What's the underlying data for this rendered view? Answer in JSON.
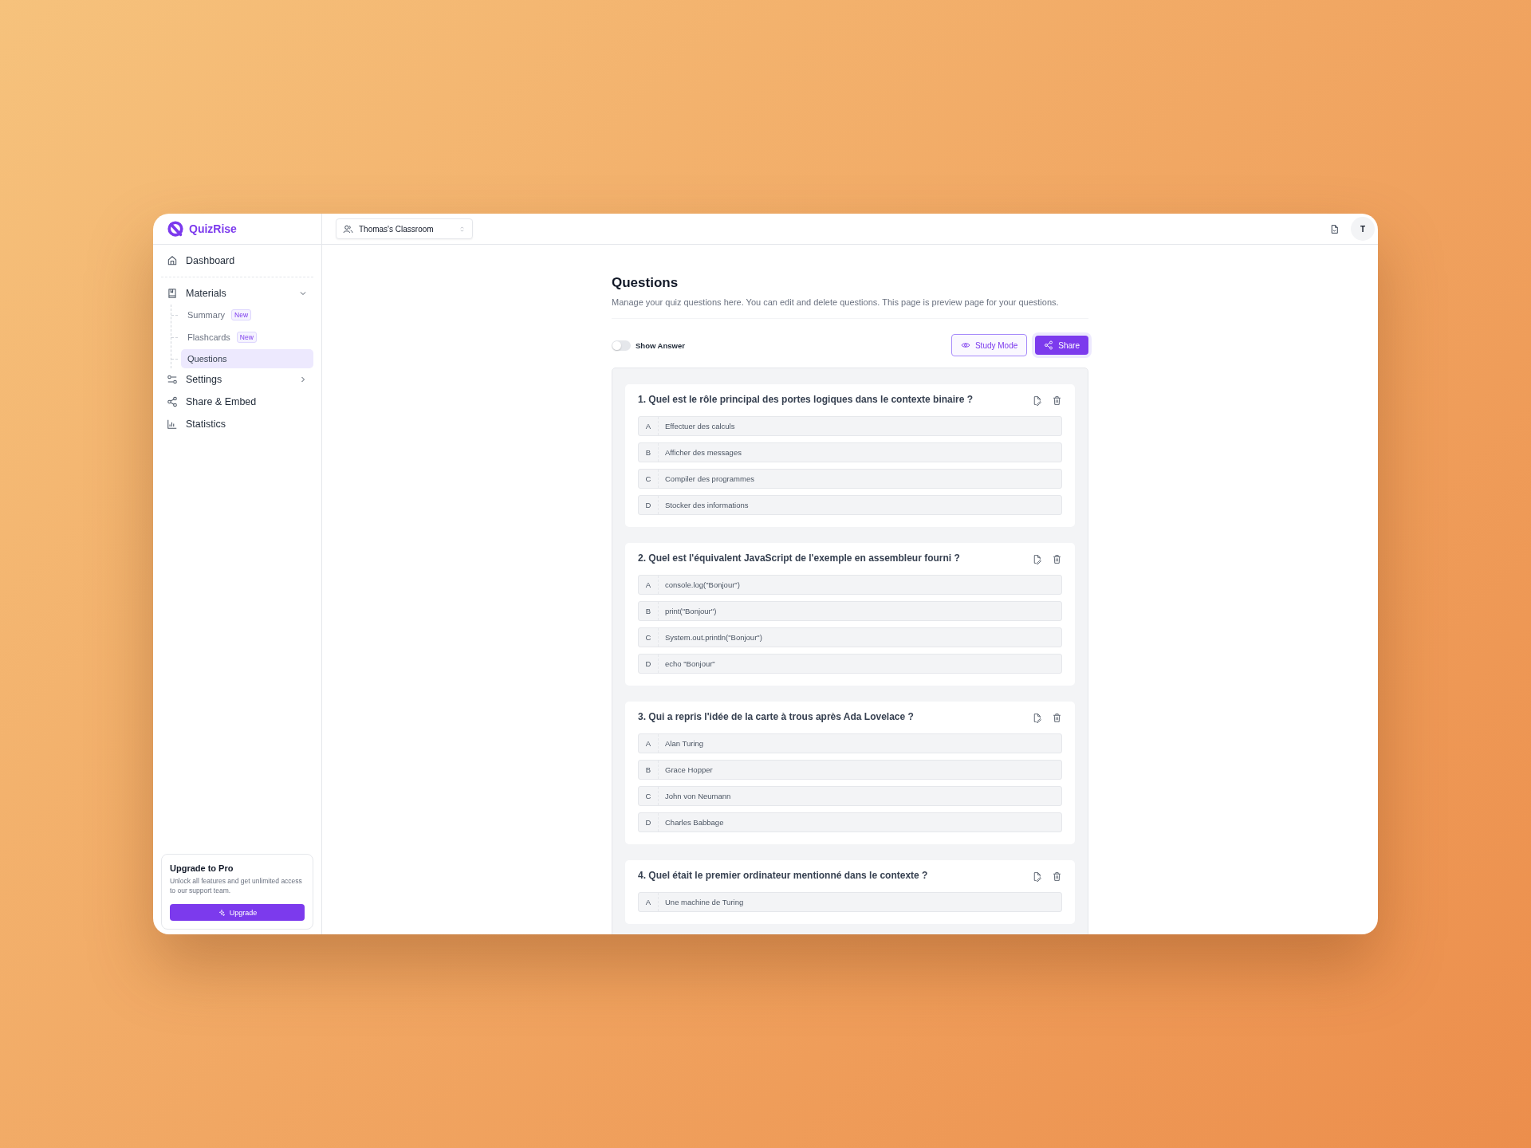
{
  "brand": {
    "name": "QuizRise"
  },
  "header": {
    "classroom": "Thomas's Classroom",
    "avatar": "T"
  },
  "sidebar": {
    "items": [
      {
        "label": "Dashboard",
        "selected": false
      },
      {
        "label": "Materials",
        "expanded": true,
        "children": [
          {
            "label": "Summary",
            "badge": "New",
            "selected": false
          },
          {
            "label": "Flashcards",
            "badge": "New",
            "selected": false
          },
          {
            "label": "Questions",
            "selected": true
          }
        ]
      },
      {
        "label": "Settings",
        "expanded": false
      },
      {
        "label": "Share & Embed",
        "selected": false
      },
      {
        "label": "Statistics",
        "selected": false
      }
    ],
    "upgrade": {
      "title": "Upgrade to Pro",
      "text": "Unlock all features and get unlimited access to our support team.",
      "button": "Upgrade"
    }
  },
  "page": {
    "title": "Questions",
    "description": "Manage your quiz questions here. You can edit and delete questions. This page is preview page for your questions.",
    "show_answer": {
      "label": "Show Answer",
      "on": false
    },
    "buttons": {
      "study": "Study Mode",
      "share": "Share"
    }
  },
  "questions": [
    {
      "title": "1. Quel est le rôle principal des portes logiques dans le contexte binaire ?",
      "options": [
        {
          "letter": "A",
          "text": "Effectuer des calculs"
        },
        {
          "letter": "B",
          "text": "Afficher des messages"
        },
        {
          "letter": "C",
          "text": "Compiler des programmes"
        },
        {
          "letter": "D",
          "text": "Stocker des informations"
        }
      ]
    },
    {
      "title": "2. Quel est l'équivalent JavaScript de l'exemple en assembleur fourni ?",
      "options": [
        {
          "letter": "A",
          "text": "console.log(\"Bonjour\")"
        },
        {
          "letter": "B",
          "text": "print(\"Bonjour\")"
        },
        {
          "letter": "C",
          "text": "System.out.println(\"Bonjour\")"
        },
        {
          "letter": "D",
          "text": "echo \"Bonjour\""
        }
      ]
    },
    {
      "title": "3. Qui a repris l'idée de la carte à trous après Ada Lovelace ?",
      "options": [
        {
          "letter": "A",
          "text": "Alan Turing"
        },
        {
          "letter": "B",
          "text": "Grace Hopper"
        },
        {
          "letter": "C",
          "text": "John von Neumann"
        },
        {
          "letter": "D",
          "text": "Charles Babbage"
        }
      ]
    },
    {
      "title": "4. Quel était le premier ordinateur mentionné dans le contexte ?",
      "options": [
        {
          "letter": "A",
          "text": "Une machine de Turing"
        }
      ]
    }
  ]
}
